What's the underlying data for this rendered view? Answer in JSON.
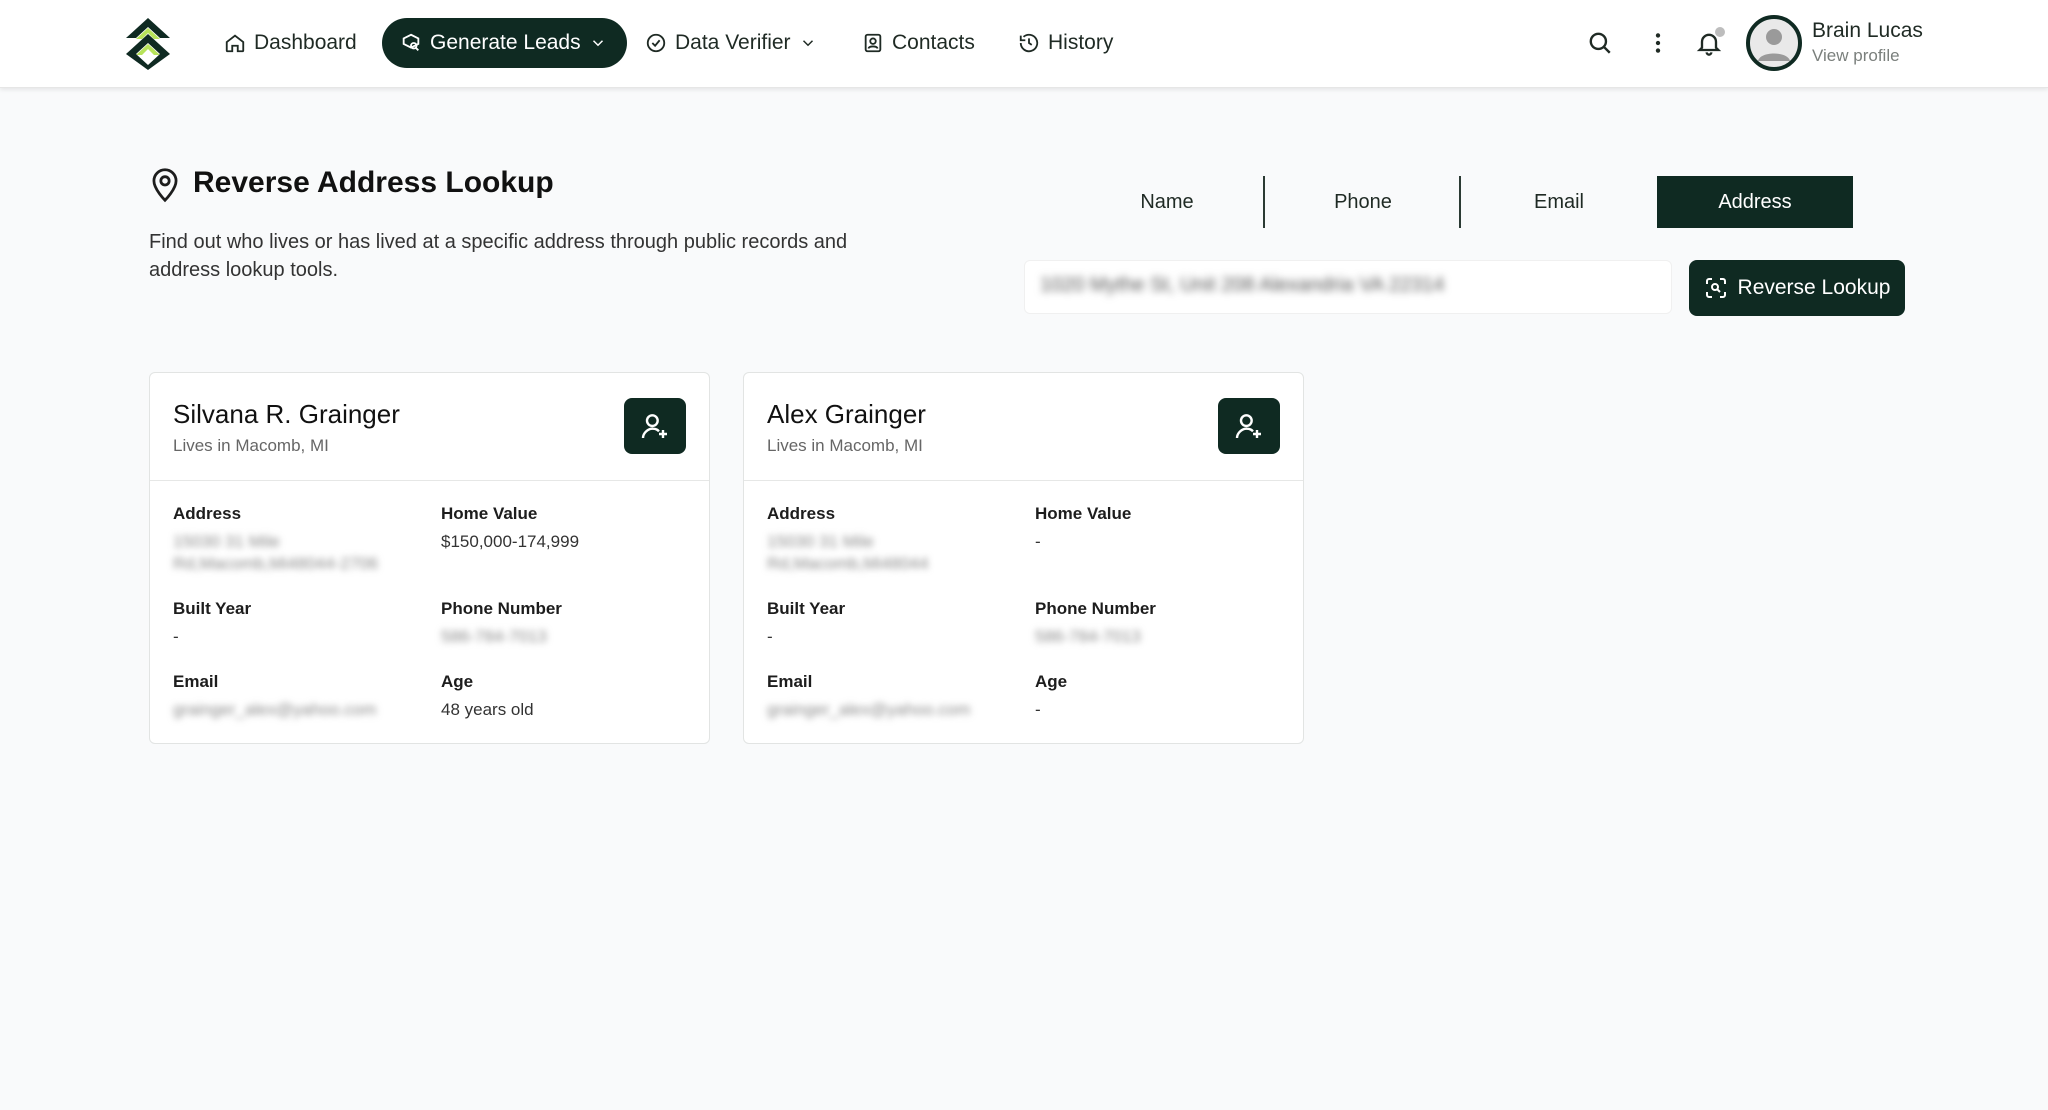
{
  "nav": {
    "items": [
      {
        "label": "Dashboard",
        "icon": "home-icon"
      },
      {
        "label": "Generate Leads",
        "icon": "leads-icon",
        "active": true
      },
      {
        "label": "Data Verifier",
        "icon": "check-circle-icon"
      },
      {
        "label": "Contacts",
        "icon": "contacts-icon"
      },
      {
        "label": "History",
        "icon": "history-icon"
      }
    ],
    "profile_name": "Brain Lucas",
    "profile_link": "View profile"
  },
  "header": {
    "title": "Reverse Address Lookup",
    "description": "Find out who lives or has lived at a specific address through public records and address lookup tools."
  },
  "tabs": [
    "Name",
    "Phone",
    "Email",
    "Address"
  ],
  "active_tab": "Address",
  "search": {
    "value": "1020 Mythe St, Unit 208 Alexandria VA 22314",
    "button_label": "Reverse Lookup"
  },
  "labels": {
    "address": "Address",
    "home_value": "Home Value",
    "built_year": "Built Year",
    "phone_number": "Phone Number",
    "email": "Email",
    "age": "Age"
  },
  "results": [
    {
      "name": "Silvana R. Grainger",
      "location": "Lives in Macomb, MI",
      "address_line1": "15030 31 Mile",
      "address_line2": "Rd,Macomb,Mi48044-2706",
      "home_value": "$150,000-174,999",
      "built_year": "-",
      "phone": "586-784-7013",
      "email": "grainger_alex@yahoo.com",
      "age": "48 years old"
    },
    {
      "name": "Alex Grainger",
      "location": "Lives in Macomb, MI",
      "address_line1": "15030 31 Mile",
      "address_line2": "Rd,Macomb,Mi48044",
      "home_value": "-",
      "built_year": "-",
      "phone": "586-784-7013",
      "email": "grainger_alex@yahoo.com",
      "age": "-"
    }
  ],
  "colors": {
    "brand_dark": "#0f2a22",
    "logo_green": "#b7e35a"
  }
}
